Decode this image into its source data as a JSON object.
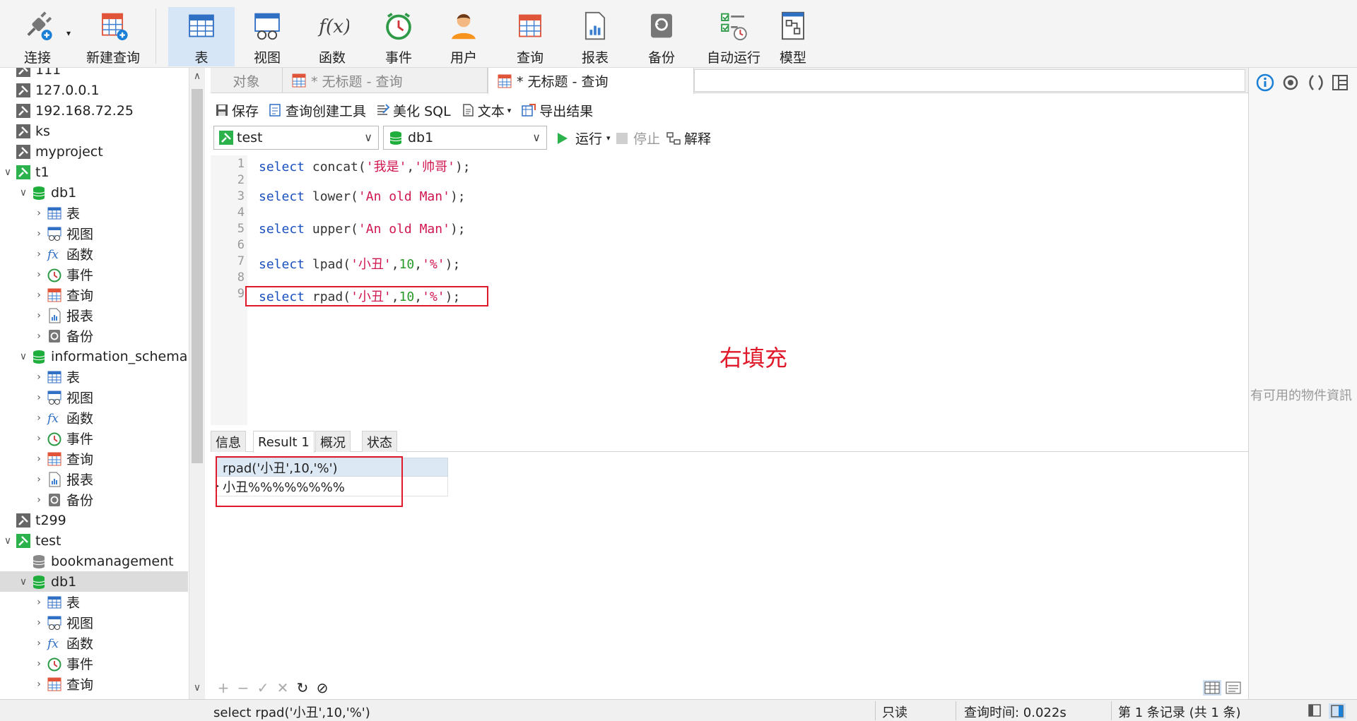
{
  "toolbar": {
    "items": [
      {
        "label": "连接",
        "icon": "plug-icon"
      },
      {
        "label": "新建查询",
        "icon": "new-query-icon"
      },
      {
        "label": "表",
        "icon": "table-icon"
      },
      {
        "label": "视图",
        "icon": "view-icon"
      },
      {
        "label": "函数",
        "icon": "function-icon"
      },
      {
        "label": "事件",
        "icon": "clock-icon"
      },
      {
        "label": "用户",
        "icon": "user-icon"
      },
      {
        "label": "查询",
        "icon": "query-icon"
      },
      {
        "label": "报表",
        "icon": "report-icon"
      },
      {
        "label": "备份",
        "icon": "backup-icon"
      },
      {
        "label": "自动运行",
        "icon": "schedule-icon"
      },
      {
        "label": "模型",
        "icon": "model-icon"
      }
    ],
    "active": "表"
  },
  "tree": [
    {
      "label": "111",
      "kind": "conn"
    },
    {
      "label": "127.0.0.1",
      "kind": "conn"
    },
    {
      "label": "192.168.72.25",
      "kind": "conn"
    },
    {
      "label": "ks",
      "kind": "conn"
    },
    {
      "label": "myproject",
      "kind": "conn"
    },
    {
      "label": "t1",
      "kind": "conn-open"
    },
    {
      "label": "db1",
      "kind": "db"
    },
    {
      "label": "表",
      "kind": "table"
    },
    {
      "label": "视图",
      "kind": "view"
    },
    {
      "label": "函数",
      "kind": "func"
    },
    {
      "label": "事件",
      "kind": "event"
    },
    {
      "label": "查询",
      "kind": "query"
    },
    {
      "label": "报表",
      "kind": "report"
    },
    {
      "label": "备份",
      "kind": "backup"
    },
    {
      "label": "information_schema",
      "kind": "db"
    },
    {
      "label": "表",
      "kind": "table"
    },
    {
      "label": "视图",
      "kind": "view"
    },
    {
      "label": "函数",
      "kind": "func"
    },
    {
      "label": "事件",
      "kind": "event"
    },
    {
      "label": "查询",
      "kind": "query"
    },
    {
      "label": "报表",
      "kind": "report"
    },
    {
      "label": "备份",
      "kind": "backup"
    },
    {
      "label": "t299",
      "kind": "conn"
    },
    {
      "label": "test",
      "kind": "conn-open"
    },
    {
      "label": "bookmanagement",
      "kind": "db-closed"
    },
    {
      "label": "db1",
      "kind": "db"
    },
    {
      "label": "表",
      "kind": "table"
    },
    {
      "label": "视图",
      "kind": "view"
    },
    {
      "label": "函数",
      "kind": "func"
    },
    {
      "label": "事件",
      "kind": "event"
    },
    {
      "label": "查询",
      "kind": "query"
    }
  ],
  "tabs": {
    "objects": "对象",
    "tab1": "* 无标题 - 查询",
    "tab2": "* 无标题 - 查询"
  },
  "query_toolbar": {
    "save": "保存",
    "builder": "查询创建工具",
    "beautify": "美化 SQL",
    "text": "文本",
    "export": "导出结果"
  },
  "selectors": {
    "connection": "test",
    "database": "db1",
    "run": "运行",
    "stop": "停止",
    "explain": "解释"
  },
  "editor": {
    "lines": [
      {
        "n": "1",
        "parts": [
          [
            "kw",
            "select"
          ],
          [
            "fn",
            " concat("
          ],
          [
            "str",
            "'我是'"
          ],
          [
            "fn",
            ","
          ],
          [
            "str",
            "'帅哥'"
          ],
          [
            "fn",
            ");"
          ]
        ]
      },
      {
        "n": "2",
        "parts": []
      },
      {
        "n": "3",
        "parts": [
          [
            "kw",
            "select"
          ],
          [
            "fn",
            " lower("
          ],
          [
            "str",
            "'An old Man'"
          ],
          [
            "fn",
            ");"
          ]
        ]
      },
      {
        "n": "4",
        "parts": []
      },
      {
        "n": "5",
        "parts": [
          [
            "kw",
            "select"
          ],
          [
            "fn",
            " upper("
          ],
          [
            "str",
            "'An old Man'"
          ],
          [
            "fn",
            ");"
          ]
        ]
      },
      {
        "n": "6",
        "parts": []
      },
      {
        "n": "7",
        "parts": [
          [
            "kw",
            "select"
          ],
          [
            "fn",
            " lpad("
          ],
          [
            "str",
            "'小丑'"
          ],
          [
            "fn",
            ","
          ],
          [
            "num",
            "10"
          ],
          [
            "fn",
            ","
          ],
          [
            "str",
            "'%'"
          ],
          [
            "fn",
            ");"
          ]
        ]
      },
      {
        "n": "8",
        "parts": []
      },
      {
        "n": "9",
        "parts": [
          [
            "kw",
            "select"
          ],
          [
            "fn",
            " rpad("
          ],
          [
            "str",
            "'小丑'"
          ],
          [
            "fn",
            ","
          ],
          [
            "num",
            "10"
          ],
          [
            "fn",
            ","
          ],
          [
            "str",
            "'%'"
          ],
          [
            "fn",
            ");"
          ]
        ]
      }
    ],
    "annotation": "右填充"
  },
  "result_tabs": [
    "信息",
    "Result 1",
    "概况",
    "状态"
  ],
  "result_active": "Result 1",
  "grid": {
    "header": "rpad('小丑',10,'%')",
    "rows": [
      "小丑%%%%%%%%"
    ]
  },
  "status": {
    "sql": "select rpad('小丑',10,'%')",
    "mode": "只读",
    "time": "查询时间: 0.022s",
    "records": "第 1 条记录 (共 1 条)"
  },
  "right_panel": {
    "message": "有可用的物件資訊"
  },
  "colors": {
    "accent": "#1a4fbf",
    "string": "#d0164f",
    "number": "#2a9a2a",
    "annotation": "#e0192b",
    "conn_open": "#2bb24c",
    "db": "#1fae3c"
  }
}
